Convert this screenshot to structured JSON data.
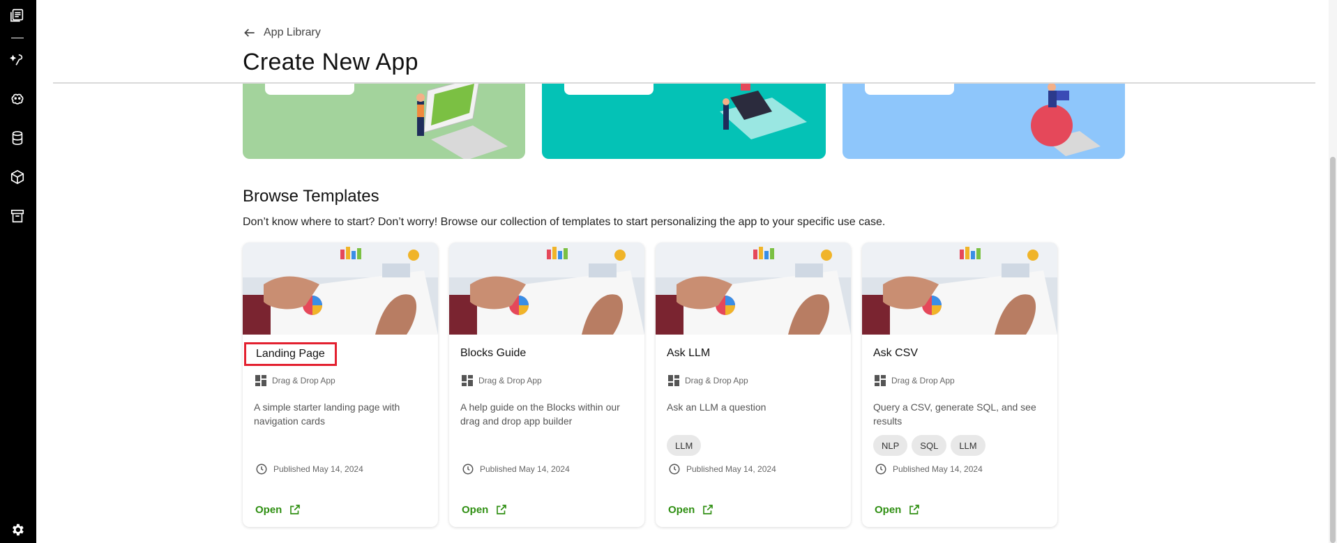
{
  "sidebar": {
    "icons": [
      "library-icon",
      "magic-icon",
      "brain-icon",
      "database-icon",
      "cube-icon",
      "archive-icon",
      "gear-icon"
    ]
  },
  "header": {
    "back_label": "App Library",
    "title": "Create New App"
  },
  "browse": {
    "title": "Browse Templates",
    "description": "Don’t know where to start? Don’t worry! Browse our collection of templates to start personalizing the app to your specific use case."
  },
  "templates": [
    {
      "name": "Landing Page",
      "type": "Drag & Drop App",
      "description": "A simple starter landing page with navigation cards",
      "tags": [],
      "published": "Published May 14, 2024",
      "open_label": "Open"
    },
    {
      "name": "Blocks Guide",
      "type": "Drag & Drop App",
      "description": "A help guide on the Blocks within our drag and drop app builder",
      "tags": [],
      "published": "Published May 14, 2024",
      "open_label": "Open"
    },
    {
      "name": "Ask LLM",
      "type": "Drag & Drop App",
      "description": "Ask an LLM a question",
      "tags": [
        "LLM"
      ],
      "published": "Published May 14, 2024",
      "open_label": "Open"
    },
    {
      "name": "Ask CSV",
      "type": "Drag & Drop App",
      "description": "Query a CSV, generate SQL, and see results",
      "tags": [
        "NLP",
        "SQL",
        "LLM"
      ],
      "published": "Published May 14, 2024",
      "open_label": "Open"
    }
  ],
  "colors": {
    "sidebar_bg": "#000000",
    "banner_green": "#a3d39c",
    "banner_teal": "#04c2b6",
    "banner_blue": "#8ec6fb",
    "open_link": "#2f8f12",
    "highlight": "#e3202f"
  }
}
